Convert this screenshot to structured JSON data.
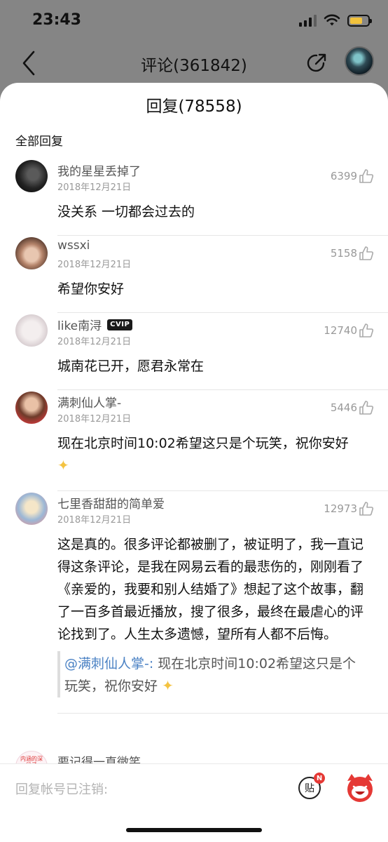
{
  "status_bar": {
    "time": "23:43"
  },
  "nav": {
    "title": "评论(361842)"
  },
  "sheet": {
    "title": "回复(78558)",
    "section_label": "全部回复"
  },
  "comments": [
    {
      "username": "我的星星丢掉了",
      "date": "2018年12月21日",
      "likes": "6399",
      "text": "没关系 一切都会过去的"
    },
    {
      "username": "wssxi",
      "date": "2018年12月21日",
      "likes": "5158",
      "text": "希望你安好"
    },
    {
      "username": "like南浔",
      "badge": "CVIP",
      "date": "2018年12月21日",
      "likes": "12740",
      "text": "城南花已开，愿君永常在"
    },
    {
      "username": "满刺仙人掌-",
      "date": "2018年12月21日",
      "likes": "5446",
      "text": "现在北京时间10:02希望这只是个玩笑，祝你安好"
    },
    {
      "username": "七里香甜甜的简单爱",
      "date": "2018年12月21日",
      "likes": "12973",
      "text": "这是真的。很多评论都被删了，被证明了，我一直记得这条评论，是我在网易云看的最悲伤的，刚刚看了《亲爱的，我要和别人结婚了》想起了这个故事，翻了一百多首最近播放，搜了很多，最终在最虐心的评论找到了。人生太多遗憾，望所有人都不后悔。",
      "quote": {
        "mention": "@满刺仙人掌-:",
        "text": " 现在北京时间10:02希望这只是个玩笑，祝你安好"
      }
    },
    {
      "username": "要记得一直微笑",
      "avatar_text": "内涵的深段子"
    }
  ],
  "reply_bar": {
    "placeholder": "回复帐号已注销:",
    "tie_label": "贴",
    "tie_badge": "N"
  },
  "colors": {
    "mention": "#4b82c4",
    "star": "#f4c341",
    "badge": "#e53935"
  }
}
